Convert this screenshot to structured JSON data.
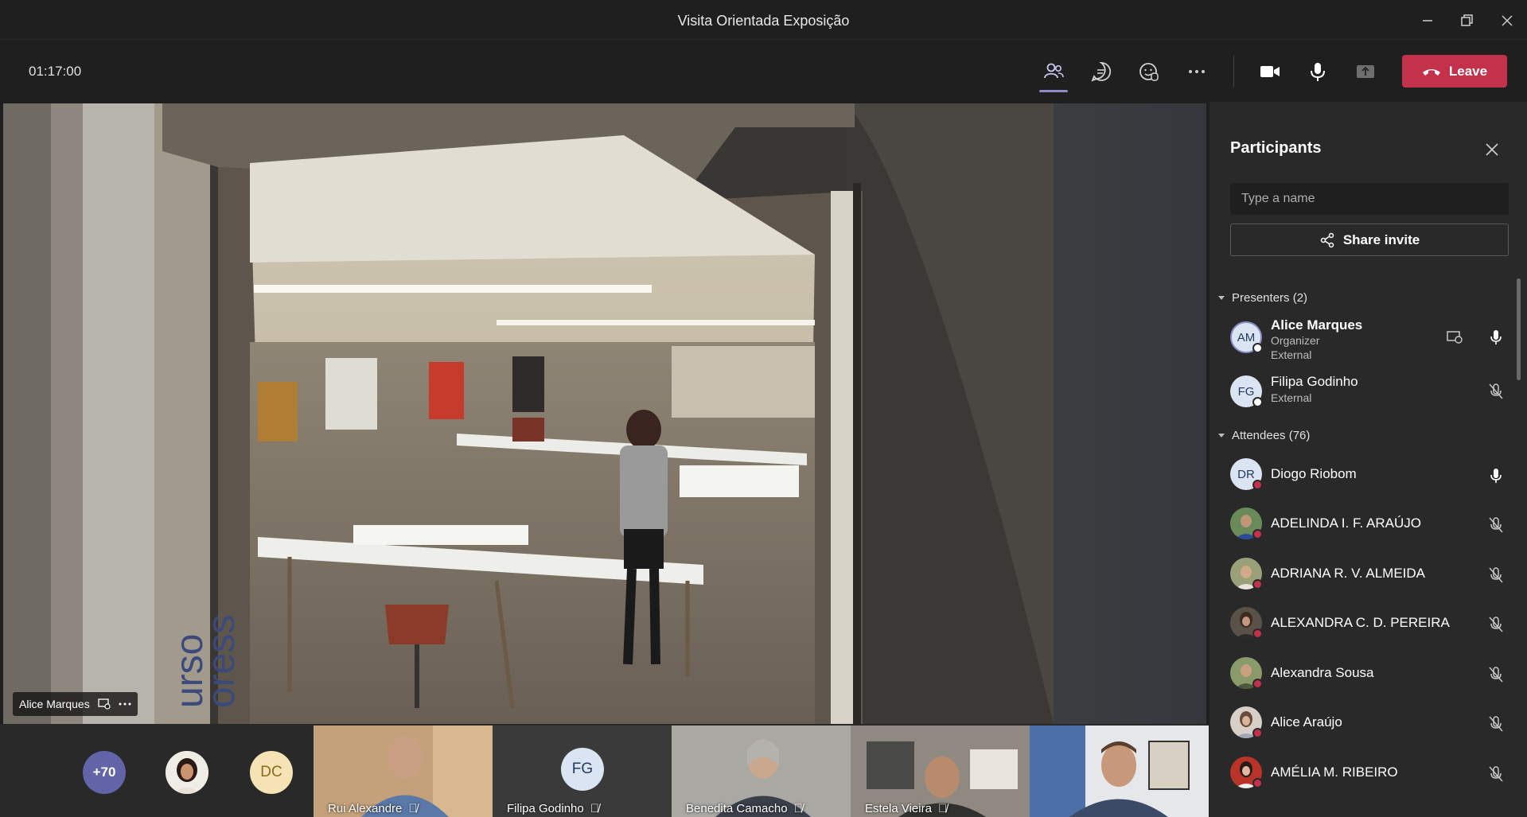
{
  "window": {
    "title": "Visita Orientada Exposição"
  },
  "toolbar": {
    "timer": "01:17:00",
    "leave_label": "Leave"
  },
  "stage": {
    "speaker_name": "Alice Marques"
  },
  "strip": {
    "overflow_count": "+70",
    "dc_initials": "DC",
    "fg_initials": "FG",
    "tiles": [
      {
        "name": "Rui Alexandre"
      },
      {
        "name": "Filipa Godinho"
      },
      {
        "name": "Benedita Camacho"
      },
      {
        "name": "Estela Vieira"
      },
      {
        "name": ""
      }
    ]
  },
  "participants": {
    "title": "Participants",
    "search_placeholder": "Type a name",
    "share_label": "Share invite",
    "presenters_label": "Presenters (2)",
    "attendees_label": "Attendees (76)",
    "presenters": [
      {
        "initials": "AM",
        "name": "Alice Marques",
        "role": "Organizer",
        "tag": "External"
      },
      {
        "initials": "FG",
        "name": "Filipa Godinho",
        "tag": "External"
      }
    ],
    "attendees": [
      {
        "initials": "DR",
        "name": "Diogo Riobom"
      },
      {
        "name": "ADELINDA I. F. ARAÚJO"
      },
      {
        "name": "ADRIANA R. V. ALMEIDA"
      },
      {
        "name": "ALEXANDRA C. D. PEREIRA"
      },
      {
        "name": "Alexandra Sousa"
      },
      {
        "name": "Alice Araújo"
      },
      {
        "name": "AMÉLIA M. RIBEIRO"
      }
    ]
  },
  "colors": {
    "leave": "#c4314b",
    "accent": "#6264a7",
    "busy": "#c4314b"
  }
}
